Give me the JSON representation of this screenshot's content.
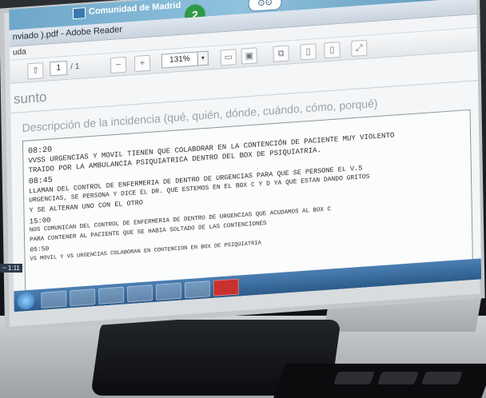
{
  "desktop": {
    "banner_text": "Comunidad de Madrid",
    "green_icon_glyph": "2",
    "clock_icon_glyph": "⊙⊙"
  },
  "window": {
    "title": "nviado ).pdf - Adobe Reader",
    "menu_item": "uda"
  },
  "toolbar": {
    "page_current": "1",
    "page_total": "/ 1",
    "zoom": "131%",
    "zoom_arrow": "▾"
  },
  "document": {
    "asunto_label": "sunto",
    "description_label": "Descripción de la incidencia (qué, quién, dónde, cuándo, cómo, porqué)",
    "lines": [
      "08:20",
      "VVSS URGENCIAS Y MOVIL TIENEN QUE COLABORAR EN LA CONTENCIÓN DE PACIENTE MUY VIOLENTO",
      "TRAIDO POR LA AMBULANCIA PSIQUIATRICA DENTRO DEL BOX DE PSIQUIATRIA.",
      "08:45",
      "LLAMAN DEL CONTROL DE ENFERMERIA DE DENTRO DE URGENCIAS PARA QUE SE PERSONE EL V.S",
      "URGENCIAS, SE PERSONA Y DICE EL DR. QUE ESTEMOS EN EL BOX C Y D YA QUE ESTAN DANDO GRITOS",
      "Y SE ALTERAN UNO CON EL OTRO",
      "15:00",
      "NOS COMUNICAN DEL CONTROL DE ENFERMERIA DE DENTRO DE URGENCIAS QUE ACUDAMOS AL BOX C",
      "PARA CONTENER AL PACIENTE QUE SE HABIA SOLTADO DE LAS CONTENCIONES",
      "05:50",
      "VS MOVIL Y VS URGENCIAS COLABORAN EN CONTENCION EN BOX DE PSIQUIATRIA"
    ]
  },
  "taskbar": {
    "tray_text": "~ 1:11"
  },
  "colors": {
    "accent": "#2c5b8a",
    "taskbar_close": "#c93030"
  }
}
